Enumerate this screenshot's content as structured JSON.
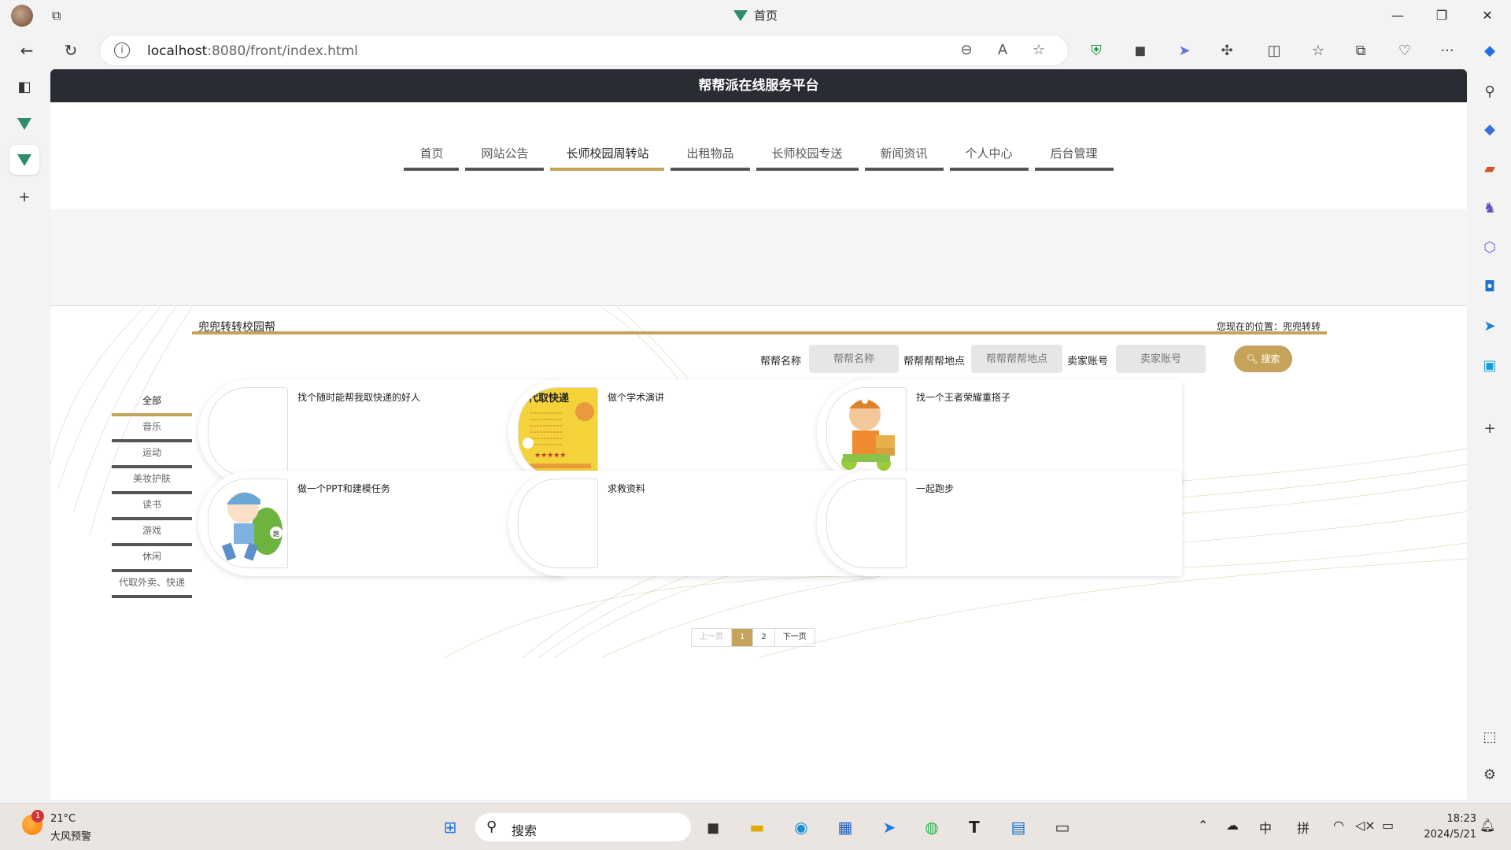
{
  "browser": {
    "title": "首页",
    "url_host": "localhost",
    "url_rest": ":8080/front/index.html"
  },
  "site": {
    "title": "帮帮派在线服务平台",
    "menu": [
      {
        "label": "首页",
        "active": false
      },
      {
        "label": "网站公告",
        "active": false
      },
      {
        "label": "长师校园周转站",
        "active": true
      },
      {
        "label": "出租物品",
        "active": false
      },
      {
        "label": "长师校园专送",
        "active": false
      },
      {
        "label": "新闻资讯",
        "active": false
      },
      {
        "label": "个人中心",
        "active": false
      },
      {
        "label": "后台管理",
        "active": false
      }
    ]
  },
  "content": {
    "section_title": "兜兜转转校园帮",
    "location": "您现在的位置：兜兜转转",
    "search": {
      "name_label": "帮帮名称",
      "name_placeholder": "帮帮名称",
      "place_label": "帮帮帮帮地点",
      "place_placeholder": "帮帮帮帮地点",
      "seller_label": "卖家账号",
      "seller_placeholder": "卖家账号",
      "button": "搜索"
    },
    "categories": [
      "全部",
      "音乐",
      "运动",
      "美妆护肤",
      "读书",
      "游戏",
      "休闲",
      "代取外卖、快递"
    ],
    "cards": [
      {
        "title": "找个随时能帮我取快递的好人",
        "image": "none"
      },
      {
        "title": "做个学术演讲",
        "image": "express-poster"
      },
      {
        "title": "找一个王者荣耀重搭子",
        "image": "courier-character"
      },
      {
        "title": "做一个PPT和建模任务",
        "image": "runner-character"
      },
      {
        "title": "求救资料",
        "image": "none"
      },
      {
        "title": "一起跑步",
        "image": "none"
      }
    ],
    "pager": {
      "prev": "上一页",
      "pages": [
        "1",
        "2"
      ],
      "current": "1",
      "next": "下一页"
    }
  },
  "taskbar": {
    "weather_badge": "1",
    "temperature": "21°C",
    "weather_desc": "大风预警",
    "search_text": "搜索",
    "ime_lang": "中",
    "ime_mode": "拼",
    "time": "18:23",
    "date": "2024/5/21"
  },
  "colors": {
    "accent": "#c5a35b",
    "header": "#2a2c33"
  }
}
